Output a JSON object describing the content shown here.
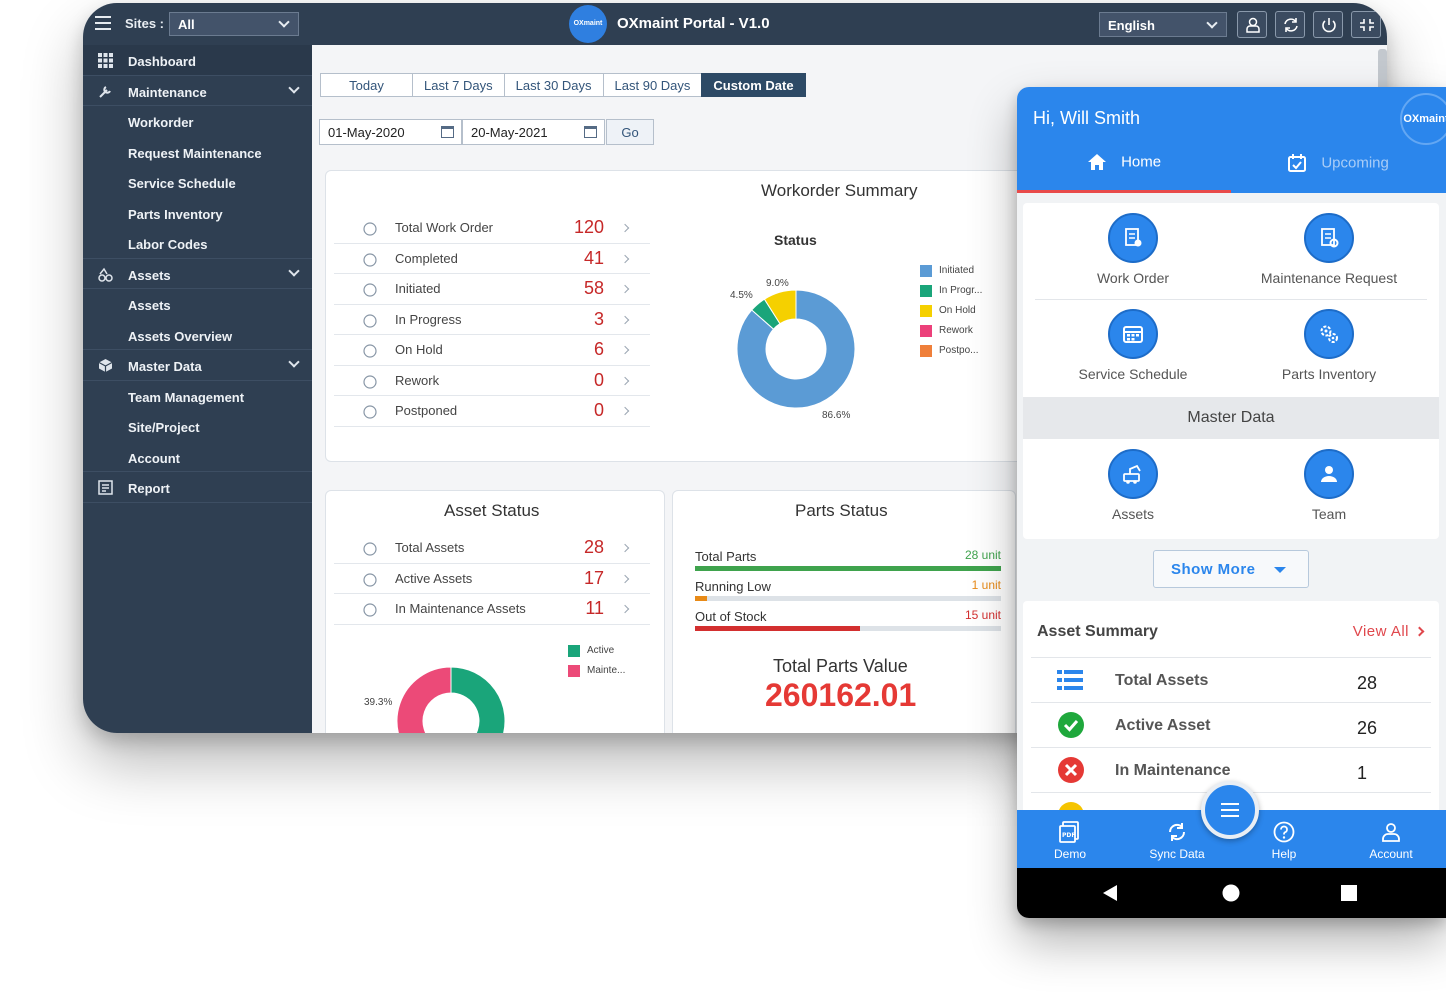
{
  "desktop": {
    "topbar": {
      "sites_label": "Sites :",
      "sites_value": "All",
      "logo_text": "OXmaint",
      "title": "OXmaint Portal - V1.0",
      "language": "English"
    },
    "sidebar": {
      "items": [
        {
          "label": "Dashboard",
          "icon": "grid-icon"
        },
        {
          "label": "Maintenance",
          "icon": "wrench-icon"
        },
        {
          "label": "Workorder"
        },
        {
          "label": "Request Maintenance"
        },
        {
          "label": "Service Schedule"
        },
        {
          "label": "Parts Inventory"
        },
        {
          "label": "Labor Codes"
        },
        {
          "label": "Assets",
          "icon": "assets-icon"
        },
        {
          "label": "Assets"
        },
        {
          "label": "Assets Overview"
        },
        {
          "label": "Master Data",
          "icon": "cube-icon"
        },
        {
          "label": "Team Management"
        },
        {
          "label": "Site/Project"
        },
        {
          "label": "Account"
        },
        {
          "label": "Report",
          "icon": "report-icon"
        }
      ]
    },
    "date_filter": {
      "tabs": [
        "Today",
        "Last 7 Days",
        "Last 30 Days",
        "Last 90 Days",
        "Custom Date"
      ],
      "selected": "Custom Date",
      "from": "01-May-2020",
      "to": "20-May-2021",
      "go": "Go"
    },
    "workorder_summary": {
      "title": "Workorder Summary",
      "rows": [
        {
          "label": "Total Work Order",
          "value": "120"
        },
        {
          "label": "Completed",
          "value": "41"
        },
        {
          "label": "Initiated",
          "value": "58"
        },
        {
          "label": "In Progress",
          "value": "3"
        },
        {
          "label": "On Hold",
          "value": "6"
        },
        {
          "label": "Rework",
          "value": "0"
        },
        {
          "label": "Postponed",
          "value": "0"
        }
      ]
    },
    "asset_status": {
      "title": "Asset Status",
      "rows": [
        {
          "label": "Total Assets",
          "value": "28"
        },
        {
          "label": "Active Assets",
          "value": "17"
        },
        {
          "label": "In Maintenance Assets",
          "value": "11"
        }
      ]
    },
    "parts_status": {
      "title": "Parts Status",
      "rows": [
        {
          "label": "Total Parts",
          "unit": "28 unit",
          "fraction": 1.0,
          "color": "#3fa34d"
        },
        {
          "label": "Running Low",
          "unit": "1 unit",
          "fraction": 0.04,
          "color": "#e88a17"
        },
        {
          "label": "Out of Stock",
          "unit": "15 unit",
          "fraction": 0.54,
          "color": "#d32f2f"
        }
      ],
      "value_title": "Total Parts Value",
      "value": "260162.01"
    }
  },
  "chart_data": [
    {
      "type": "pie",
      "title": "Status",
      "categories": [
        "Initiated",
        "In Progr...",
        "On Hold",
        "Rework",
        "Postpo..."
      ],
      "values": [
        86.6,
        4.5,
        9.0,
        0,
        0
      ],
      "labels": [
        "86.6%",
        "4.5%",
        "9.0%"
      ],
      "colors": [
        "#5b9bd5",
        "#1aa57a",
        "#f5d000",
        "#ec407a",
        "#ef7f3a"
      ],
      "legend": "right"
    },
    {
      "type": "pie",
      "categories": [
        "Active",
        "Mainte..."
      ],
      "values": [
        60.7,
        39.3
      ],
      "labels": [
        "39.3%"
      ],
      "colors": [
        "#1aa57a",
        "#ec4a78"
      ],
      "legend": "top-right"
    }
  ],
  "mobile": {
    "greeting": "Hi, Will Smith",
    "logo_text": "OXmaint",
    "tabs": [
      {
        "label": "Home"
      },
      {
        "label": "Upcoming"
      }
    ],
    "quick_actions": [
      {
        "label": "Work Order"
      },
      {
        "label": "Maintenance Request"
      },
      {
        "label": "Service Schedule"
      },
      {
        "label": "Parts Inventory"
      }
    ],
    "section_title": "Master Data",
    "master_actions": [
      {
        "label": "Assets"
      },
      {
        "label": "Team"
      }
    ],
    "show_more": "Show More",
    "asset_summary": {
      "title": "Asset Summary",
      "view_all": "View All",
      "rows": [
        {
          "label": "Total Assets",
          "value": "28"
        },
        {
          "label": "Active Asset",
          "value": "26"
        },
        {
          "label": "In Maintenance",
          "value": "1"
        }
      ]
    },
    "bottom_nav": [
      {
        "label": "Demo"
      },
      {
        "label": "Sync Data"
      },
      {
        "label": "Help"
      },
      {
        "label": "Account"
      }
    ],
    "accent": "#2b86ec"
  }
}
